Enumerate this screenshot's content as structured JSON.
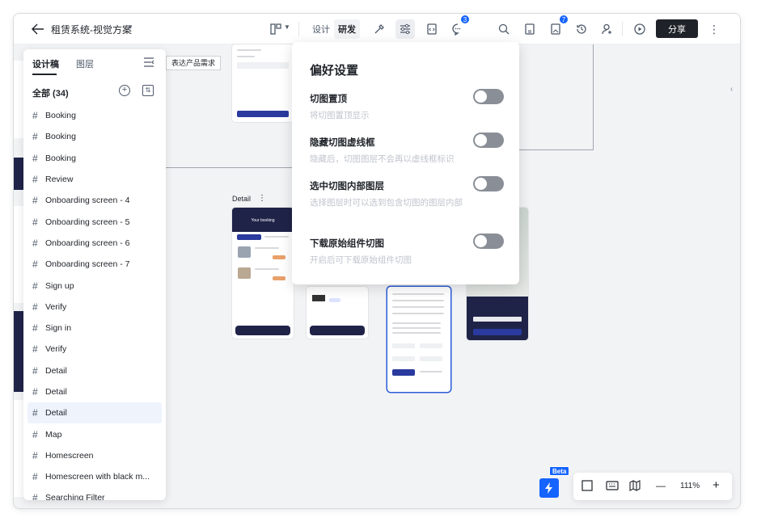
{
  "header": {
    "doc_title": "租赁系统-视觉方案",
    "modes": [
      "设计",
      "研发"
    ],
    "active_mode": "研发",
    "comment_badge": "3",
    "updates_badge": "7",
    "share_label": "分享"
  },
  "canvas": {
    "tooltip_text": "表达产品需求",
    "frame_label": "Detail",
    "phone_title": "Your booking"
  },
  "left_panel": {
    "tabs": [
      "设计稿",
      "图层"
    ],
    "active_tab": "设计稿",
    "count_label": "全部 (34)",
    "items": [
      {
        "label": "Booking"
      },
      {
        "label": "Booking"
      },
      {
        "label": "Booking"
      },
      {
        "label": "Review"
      },
      {
        "label": "Onboarding screen - 4"
      },
      {
        "label": "Onboarding screen - 5"
      },
      {
        "label": "Onboarding screen - 6"
      },
      {
        "label": "Onboarding screen - 7"
      },
      {
        "label": "Sign up"
      },
      {
        "label": "Verify"
      },
      {
        "label": "Sign in"
      },
      {
        "label": "Verify"
      },
      {
        "label": "Detail"
      },
      {
        "label": "Detail"
      },
      {
        "label": "Detail",
        "selected": true
      },
      {
        "label": "Map"
      },
      {
        "label": "Homescreen"
      },
      {
        "label": "Homescreen with black m..."
      },
      {
        "label": "Searching Filter"
      }
    ]
  },
  "preferences": {
    "title": "偏好设置",
    "options": [
      {
        "label": "切图置顶",
        "desc": "将切图置顶显示",
        "enabled": false
      },
      {
        "label": "隐藏切图虚线框",
        "desc": "隐藏后，切图图层不会再以虚线框标识",
        "enabled": false
      },
      {
        "label": "选中切图内部图层",
        "desc": "选择图层时可以选到包含切图的图层内部",
        "enabled": false
      },
      {
        "label": "下载原始组件切图",
        "desc": "开启后可下载原始组件切图",
        "enabled": false
      }
    ]
  },
  "bottom": {
    "beta_label": "Beta",
    "zoom_label": "111%"
  }
}
